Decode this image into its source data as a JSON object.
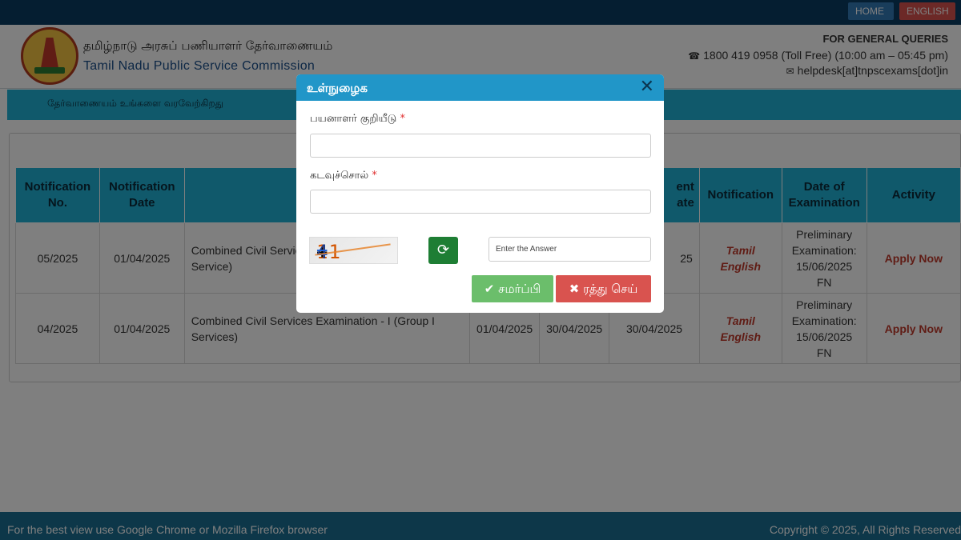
{
  "topbar": {
    "home_label": "HOME",
    "english_label": "ENGLISH"
  },
  "header": {
    "name_tamil": "தமிழ்நாடு அரசுப் பணியாளர் தேர்வாணையம்",
    "name_english": "Tamil Nadu Public Service Commission",
    "queries_title": "FOR GENERAL QUERIES",
    "phone": "1800 419 0958 (Toll Free) (10:00 am – 05:45 pm)",
    "email": "helpdesk[at]tnpscexams[dot]in",
    "phone_icon": "phone-icon",
    "mail_icon": "mail-icon"
  },
  "welcome": "தேர்வாணையம் உங்களை வரவேற்கிறது",
  "table": {
    "headers": [
      "Notification No.",
      "Notification Date",
      "",
      "",
      "",
      "ent\nate",
      "Notification",
      "Date of Examination",
      "Activity"
    ],
    "rows": [
      {
        "no": "05/2025",
        "date": "01/04/2025",
        "name": "Combined Civil Servic",
        "name_line2": "Service)",
        "start": "",
        "end": "",
        "last": "25",
        "lang1": "Tamil",
        "lang2": "English",
        "exam": "Preliminary Examination: 15/06/2025 FN",
        "activity": "Apply Now"
      },
      {
        "no": "04/2025",
        "date": "01/04/2025",
        "name": "Combined Civil Services Examination - I (Group I",
        "name_line2": "Services)",
        "start": "01/04/2025",
        "end": "30/04/2025",
        "last": "30/04/2025",
        "lang1": "Tamil",
        "lang2": "English",
        "exam": "Preliminary Examination: 15/06/2025 FN",
        "activity": "Apply Now"
      }
    ]
  },
  "footer": {
    "left": "For the best view use Google Chrome or Mozilla Firefox browser",
    "right": "Copyright © 2025, All Rights Reserved"
  },
  "modal": {
    "title": "உள்நுழைக",
    "close_icon": "close-icon",
    "username_label": "பயனாளர் குறியீடு",
    "password_label": "கடவுச்சொல்",
    "required_mark": "*",
    "captcha": {
      "a": "11",
      "op": "+",
      "b": "4",
      "eq": "="
    },
    "answer_placeholder": "Enter the Answer",
    "submit_label": "சமர்ப்பி",
    "cancel_label": "ரத்து செய்"
  },
  "colors": {
    "accent": "#21b2d6",
    "brand": "#0a3d62",
    "danger": "#d9534f",
    "success": "#5cb85c"
  }
}
